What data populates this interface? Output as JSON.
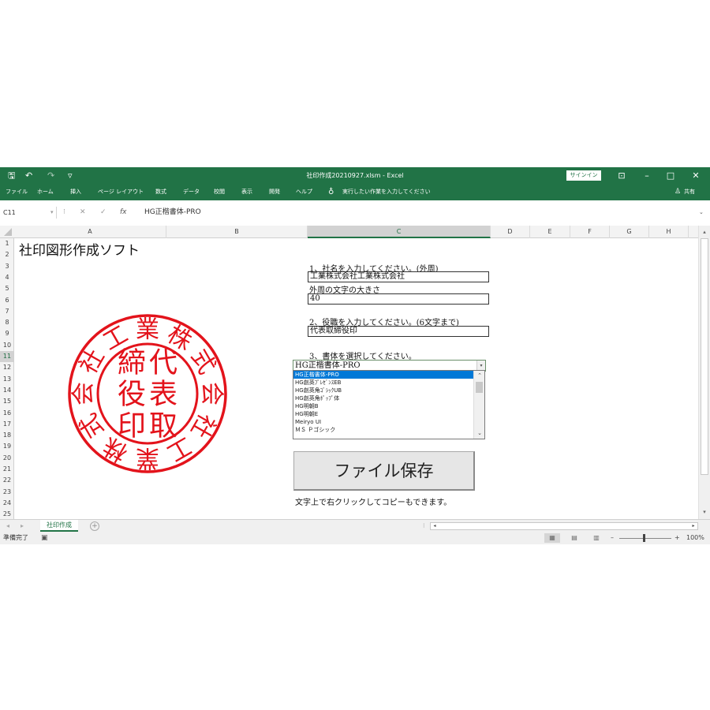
{
  "window": {
    "title": "社印作成20210927.xlsm  -  Excel",
    "signin_label": "サインイン",
    "share_label": "共有",
    "minimize": "–",
    "restore": "□",
    "close": "✕"
  },
  "quick_access": {
    "save": "🖫",
    "undo": "↶",
    "redo": "↷",
    "more": "▿"
  },
  "ribbon_tabs": [
    "ファイル",
    "ホーム",
    "挿入",
    "ページ レイアウト",
    "数式",
    "データ",
    "校閲",
    "表示",
    "開発",
    "ヘルプ"
  ],
  "tell_me": "実行したい作業を入力してください",
  "formula_bar": {
    "name_box": "C11",
    "cancel": "✕",
    "enter": "✓",
    "fx": "fx",
    "formula": "HG正楷書体-PRO"
  },
  "columns": [
    "A",
    "B",
    "C",
    "D",
    "E",
    "F",
    "G",
    "H"
  ],
  "rows": [
    "1",
    "2",
    "3",
    "4",
    "5",
    "6",
    "7",
    "8",
    "9",
    "10",
    "11",
    "12",
    "13",
    "14",
    "15",
    "16",
    "17",
    "18",
    "19",
    "20",
    "21",
    "22",
    "23",
    "24",
    "25"
  ],
  "selected_row": "11",
  "sheet": {
    "title": "社印図形作成ソフト",
    "q1_label": "1、社名を入力してください。(外周)",
    "q1_value": "工業株式会社工業株式会社",
    "q1_size_label": "外周の文字の大きさ",
    "q1_size_value": "40",
    "q2_label": "2、役職を入力してください。(6文字まで)",
    "q2_value": "代表取締役印",
    "q3_label": "3、書体を選択してください。",
    "font_selected": "HG正楷書体-PRO",
    "font_options": [
      "HG正楷書体-PRO",
      "HG創英ﾌﾟﾚｾﾞﾝｽEB",
      "HG創英角ｺﾞｼｯｸUB",
      "HG創英角ﾎﾟｯﾌﾟ体",
      "HG明朝B",
      "HG明朝E",
      "Meiryo UI",
      "ＭＳ Ｐゴシック"
    ],
    "save_button": "ファイル保存",
    "note": "文字上で右クリックしてコピーもできます。"
  },
  "seal": {
    "color": "#e3131b",
    "outer_chars": [
      "社",
      "工",
      "業",
      "株",
      "式",
      "会",
      "社",
      "工",
      "業",
      "株",
      "式",
      "会"
    ],
    "inner_rows": [
      [
        "代",
        "締"
      ],
      [
        "表",
        "役"
      ],
      [
        "取",
        "印"
      ]
    ]
  },
  "sheet_tabs": {
    "active": "社印作成",
    "add": "+"
  },
  "status": {
    "ready": "準備完了",
    "zoom": "100%",
    "minus": "–",
    "plus": "+"
  }
}
